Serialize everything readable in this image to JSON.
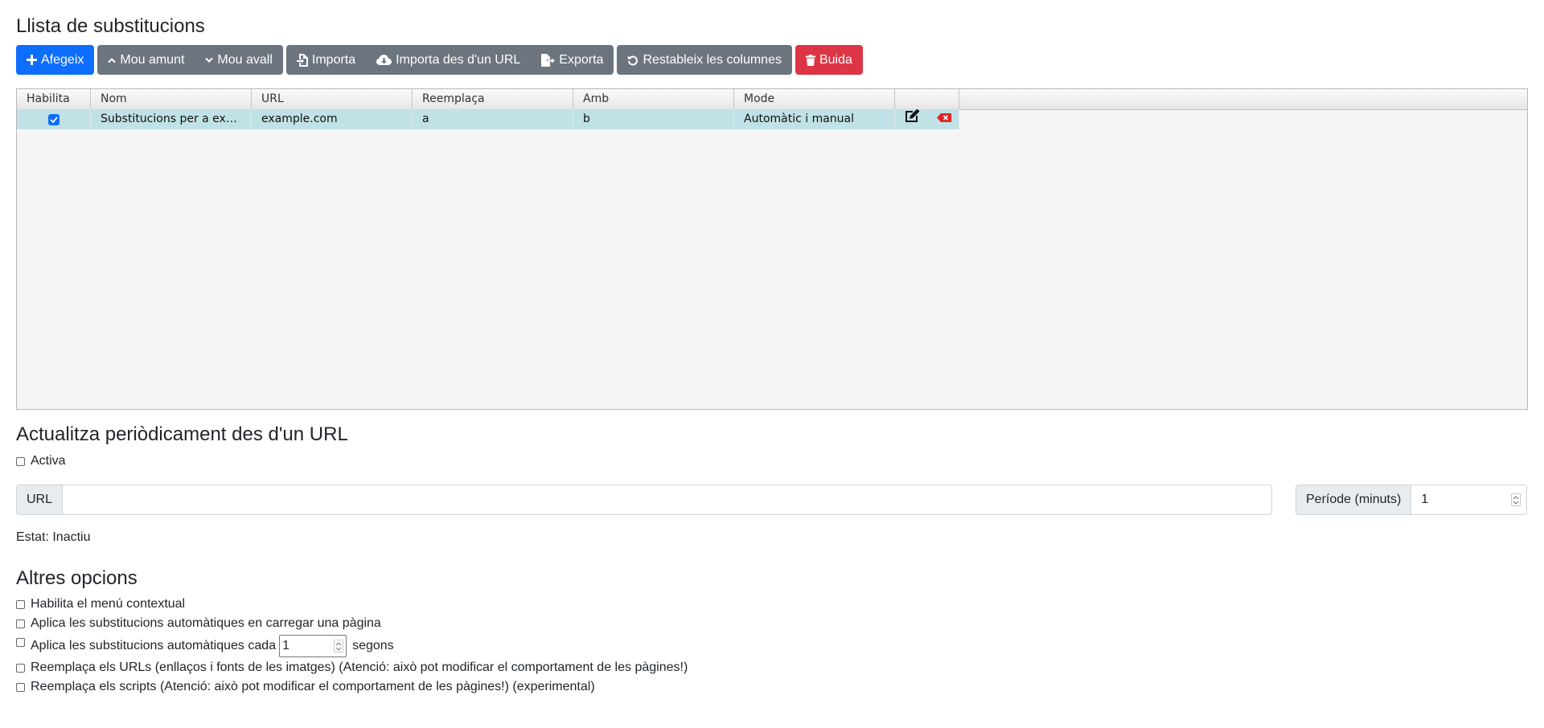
{
  "header": {
    "title": "Llista de substitucions"
  },
  "toolbar": {
    "add": "Afegeix",
    "move_up": "Mou amunt",
    "move_down": "Mou avall",
    "import": "Importa",
    "import_url": "Importa des d'un URL",
    "export": "Exporta",
    "reset_columns": "Restableix les columnes",
    "clear": "Buida"
  },
  "table": {
    "columns": [
      "Habilita",
      "Nom",
      "URL",
      "Reemplaça",
      "Amb",
      "Mode"
    ],
    "rows": [
      {
        "enabled": true,
        "name": "Substitucions per a ex…",
        "url": "example.com",
        "replace": "a",
        "with": "b",
        "mode": "Automàtic i manual"
      }
    ]
  },
  "periodic": {
    "title": "Actualitza periòdicament des d'un URL",
    "active_label": "Activa",
    "active_checked": false,
    "url_label": "URL",
    "url_value": "",
    "period_label": "Període (minuts)",
    "period_value": "1",
    "status": "Estat: Inactiu"
  },
  "other": {
    "title": "Altres opcions",
    "context_menu": "Habilita el menú contextual",
    "apply_on_load": "Aplica les substitucions automàtiques en carregar una pàgina",
    "apply_every_prefix": "Aplica les substitucions automàtiques cada",
    "apply_every_value": "1",
    "apply_every_suffix": "segons",
    "replace_urls": "Reemplaça els URLs (enllaços i fonts de les imatges) (Atenció: això pot modificar el comportament de les pàgines!)",
    "replace_scripts": "Reemplaça els scripts (Atenció: això pot modificar el comportament de les pàgines!) (experimental)"
  },
  "colors": {
    "primary": "#0d6efd",
    "secondary": "#6c757d",
    "danger": "#dc3545",
    "row_selected": "#c0e1e6"
  },
  "icons": [
    "plus-icon",
    "chevron-up-icon",
    "chevron-down-icon",
    "file-import-icon",
    "cloud-download-icon",
    "file-export-icon",
    "undo-icon",
    "trash-icon",
    "edit-icon",
    "delete-row-icon",
    "check-icon"
  ]
}
